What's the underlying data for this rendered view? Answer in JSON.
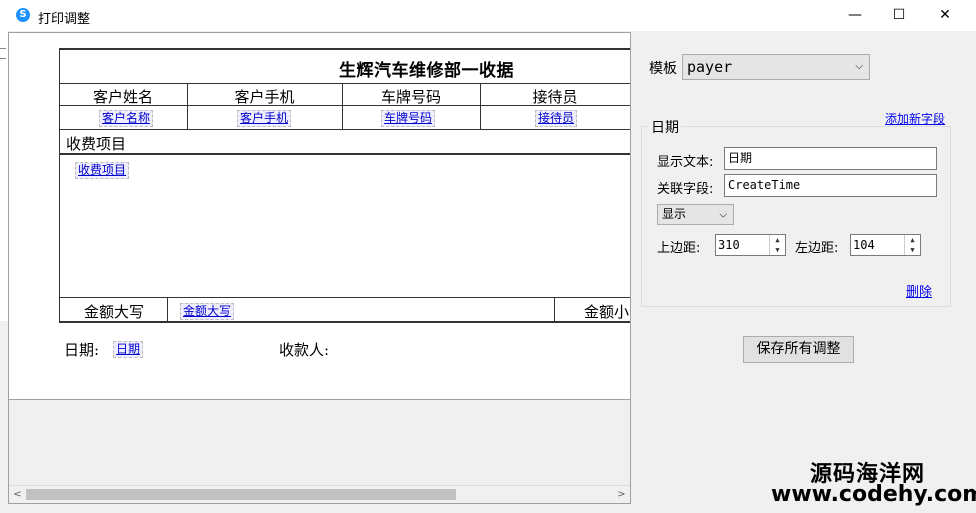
{
  "window": {
    "title": "打印调整",
    "icon": "S",
    "controls": {
      "minimize": "—",
      "maximize": "☐",
      "close": "✕"
    }
  },
  "receipt": {
    "title": "生辉汽车维修部一收据",
    "headers": [
      "客户姓名",
      "客户手机",
      "车牌号码",
      "接待员"
    ],
    "fields": [
      "客户名称",
      "客户手机",
      "车牌号码",
      "接待员"
    ],
    "items_label": "收费项目",
    "items_field": "收费项目",
    "amount_upper_label": "金额大写",
    "amount_upper_field": "金额大写",
    "amount_lower_label": "金额小",
    "date_label": "日期:",
    "date_field": "日期",
    "payee_label": "收款人:"
  },
  "scrollbar": {
    "left": "<",
    "right": ">"
  },
  "panel": {
    "template_label": "模板",
    "template_value": "payer",
    "add_field_link": "添加新字段",
    "group_title": "日期",
    "display_text_label": "显示文本:",
    "display_text_value": "日期",
    "related_field_label": "关联字段:",
    "related_field_value": "CreateTime",
    "visibility_value": "显示",
    "top_margin_label": "上边距:",
    "top_margin_value": "310",
    "left_margin_label": "左边距:",
    "left_margin_value": "104",
    "delete_link": "删除",
    "save_button": "保存所有调整"
  },
  "watermark": {
    "line1": "源码海洋网",
    "line2": "www.codehy.com"
  }
}
